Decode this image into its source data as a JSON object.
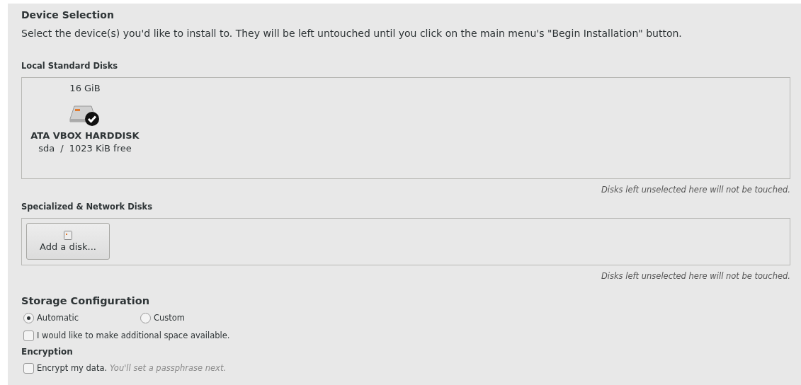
{
  "title": "Device Selection",
  "description": "Select the device(s) you'd like to install to.  They will be left untouched until you click on the main menu's \"Begin Installation\" button.",
  "local_disks": {
    "heading": "Local Standard Disks",
    "disks": [
      {
        "size": "16 GiB",
        "name": "ATA VBOX HARDDISK",
        "device": "sda",
        "separator": "/",
        "free": "1023 KiB free",
        "selected": true
      }
    ],
    "note": "Disks left unselected here will not be touched."
  },
  "network_disks": {
    "heading": "Specialized & Network Disks",
    "button": "Add a disk...",
    "note": "Disks left unselected here will not be touched."
  },
  "storage": {
    "heading": "Storage Configuration",
    "options": [
      {
        "label": "Automatic",
        "selected": true
      },
      {
        "label": "Custom",
        "selected": false
      }
    ],
    "additional_space": {
      "label": "I would like to make additional space available.",
      "checked": false
    }
  },
  "encryption": {
    "heading": "Encryption",
    "label": "Encrypt my data.",
    "hint": "You'll set a passphrase next.",
    "checked": false
  }
}
